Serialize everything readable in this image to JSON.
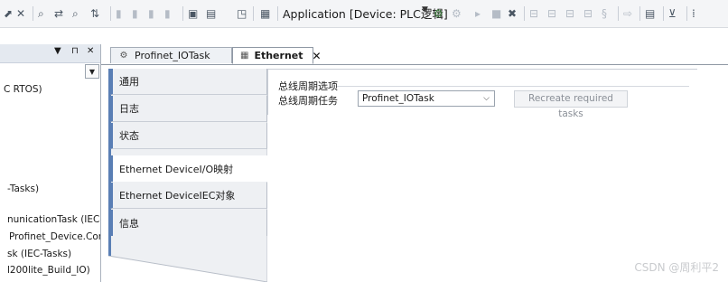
{
  "toolbar": {
    "application_selector": "Application [Device: PLC逻辑]"
  },
  "left_pane": {
    "header_buttons": [
      "▼",
      "⊓",
      "✕"
    ],
    "tree_items": [
      "C RTOS)",
      "-Tasks)",
      "nunicationTask (IEC-Task",
      "Profinet_Device.CommC",
      "sk (IEC-Tasks)",
      "l200lite_Build_IO)"
    ]
  },
  "tabs": [
    {
      "label": "Profinet_IOTask",
      "active": false
    },
    {
      "label": "Ethernet",
      "active": true,
      "close": "✕"
    }
  ],
  "side_nav": [
    {
      "label": "通用",
      "active": false
    },
    {
      "label": "日志",
      "active": false
    },
    {
      "label": "状态",
      "active": false
    },
    {
      "label": "Ethernet DeviceI/O映射",
      "active": true
    },
    {
      "label": "Ethernet DeviceIEC对象",
      "active": false
    },
    {
      "label": "信息",
      "active": false
    }
  ],
  "bus_cycle": {
    "group_title": "总线周期选项",
    "field_label": "总线周期任务",
    "selected_task": "Profinet_IOTask",
    "recreate_button": "Recreate required tasks"
  },
  "watermark": "CSDN @周利平2"
}
